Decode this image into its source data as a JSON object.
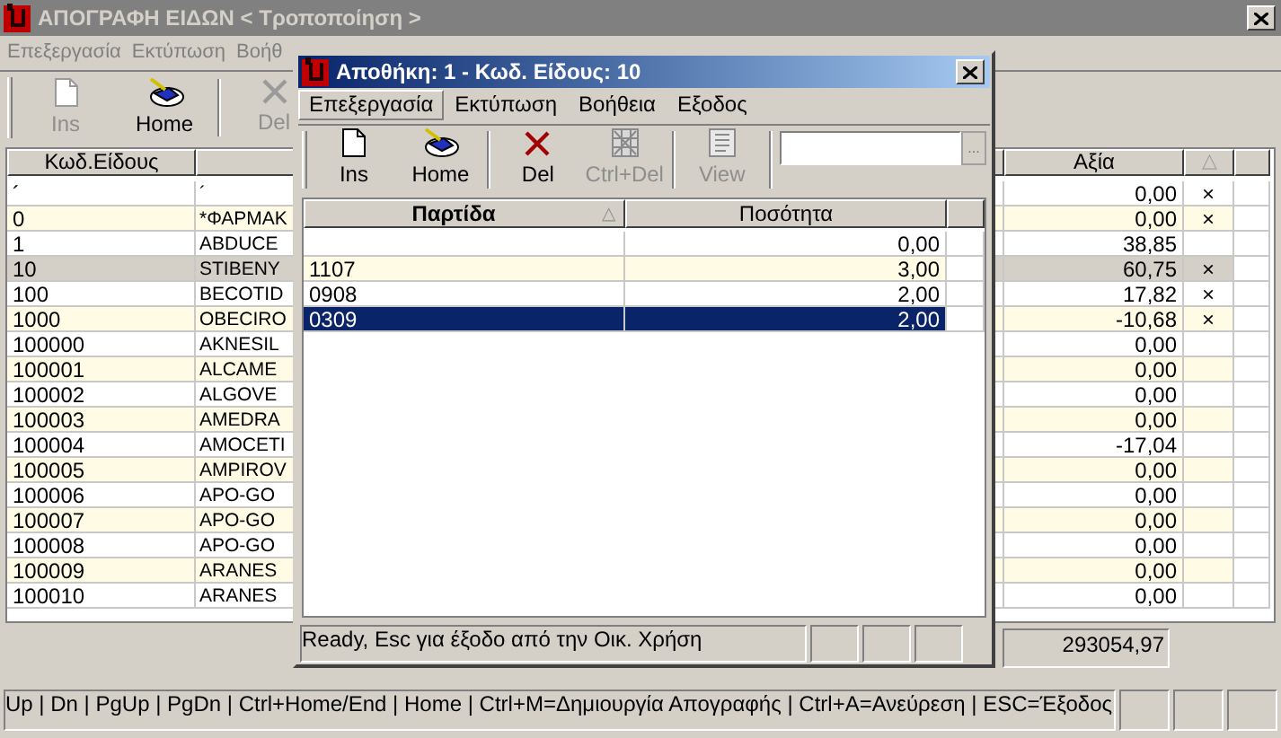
{
  "window": {
    "title": "ΑΠΟΓΡΑΦΗ ΕΙΔΩΝ < Τροποποίηση >",
    "active": false
  },
  "menu": [
    "Επεξεργασία",
    "Εκτύπωση",
    "Βοήθ"
  ],
  "toolbar": [
    {
      "label": "Ins",
      "kind": "page",
      "disabled": true
    },
    {
      "label": "Home",
      "kind": "home",
      "disabled": false
    },
    {
      "label": "Del",
      "kind": "delete",
      "disabled": true
    }
  ],
  "table": {
    "columns": [
      "Κωδ.Είδους",
      "",
      "Αξία",
      "△"
    ],
    "rows": [
      {
        "code": "´",
        "name": "´",
        "value": "0,00",
        "mark": "×",
        "selected": false
      },
      {
        "code": "0",
        "name": "*ΦΑΡΜΑΚ",
        "value": "0,00",
        "mark": "×",
        "selected": false
      },
      {
        "code": "1",
        "name": "ABDUCE",
        "value": "38,85",
        "mark": "",
        "selected": false
      },
      {
        "code": "10",
        "name": "STIBENY",
        "value": "60,75",
        "mark": "×",
        "selected": true
      },
      {
        "code": "100",
        "name": "BECOTID",
        "value": "17,82",
        "mark": "×",
        "selected": false
      },
      {
        "code": "1000",
        "name": "OBECIRO",
        "value": "-10,68",
        "mark": "×",
        "selected": false
      },
      {
        "code": "100000",
        "name": "AKNESIL",
        "value": "0,00",
        "mark": "",
        "selected": false
      },
      {
        "code": "100001",
        "name": "ALCAME",
        "value": "0,00",
        "mark": "",
        "selected": false
      },
      {
        "code": "100002",
        "name": "ALGOVE",
        "value": "0,00",
        "mark": "",
        "selected": false
      },
      {
        "code": "100003",
        "name": "AMEDRA",
        "value": "0,00",
        "mark": "",
        "selected": false
      },
      {
        "code": "100004",
        "name": "AMOCETI",
        "value": "-17,04",
        "mark": "",
        "selected": false
      },
      {
        "code": "100005",
        "name": "AMPIROV",
        "value": "0,00",
        "mark": "",
        "selected": false
      },
      {
        "code": "100006",
        "name": "APO-GO",
        "value": "0,00",
        "mark": "",
        "selected": false
      },
      {
        "code": "100007",
        "name": "APO-GO",
        "value": "0,00",
        "mark": "",
        "selected": false
      },
      {
        "code": "100008",
        "name": "APO-GO",
        "value": "0,00",
        "mark": "",
        "selected": false
      },
      {
        "code": "100009",
        "name": "ARANES",
        "value": "0,00",
        "mark": "",
        "selected": false
      },
      {
        "code": "100010",
        "name": "ARANES",
        "value": "0,00",
        "mark": "",
        "selected": false
      }
    ]
  },
  "total": "293054,97",
  "status_bar": "Up | Dn | PgUp | PgDn | Ctrl+Home/End | Home | Ctrl+M=Δημιουργία Απογραφής | Ctrl+A=Ανεύρεση | ESC=Έξοδος",
  "dialog": {
    "title": "Αποθήκη: 1 - Κωδ. Είδους: 10",
    "active": true,
    "menu": [
      {
        "label": "Επεξεργασία",
        "selected": true
      },
      {
        "label": "Εκτύπωση",
        "selected": false
      },
      {
        "label": "Βοήθεια",
        "selected": false
      },
      {
        "label": "Εξοδος",
        "selected": false
      }
    ],
    "toolbar": [
      {
        "label": "Ins",
        "kind": "page",
        "disabled": false
      },
      {
        "label": "Home",
        "kind": "home",
        "disabled": false
      },
      {
        "label": "Del",
        "kind": "delete",
        "disabled": false
      },
      {
        "label": "Ctrl+Del",
        "kind": "grid",
        "disabled": true
      },
      {
        "label": "View",
        "kind": "view",
        "disabled": true
      }
    ],
    "search_button": "...",
    "table": {
      "columns": [
        "Παρτίδα",
        "Ποσότητα"
      ],
      "sort_mark": "△",
      "rows": [
        {
          "lot": "",
          "qty": "0,00",
          "selected": false
        },
        {
          "lot": "1107",
          "qty": "3,00",
          "selected": false
        },
        {
          "lot": "0908",
          "qty": "2,00",
          "selected": false
        },
        {
          "lot": "0309",
          "qty": "2,00",
          "selected": true
        }
      ]
    },
    "status": "Ready, Esc για έξοδο από την Οικ. Χρήση"
  }
}
